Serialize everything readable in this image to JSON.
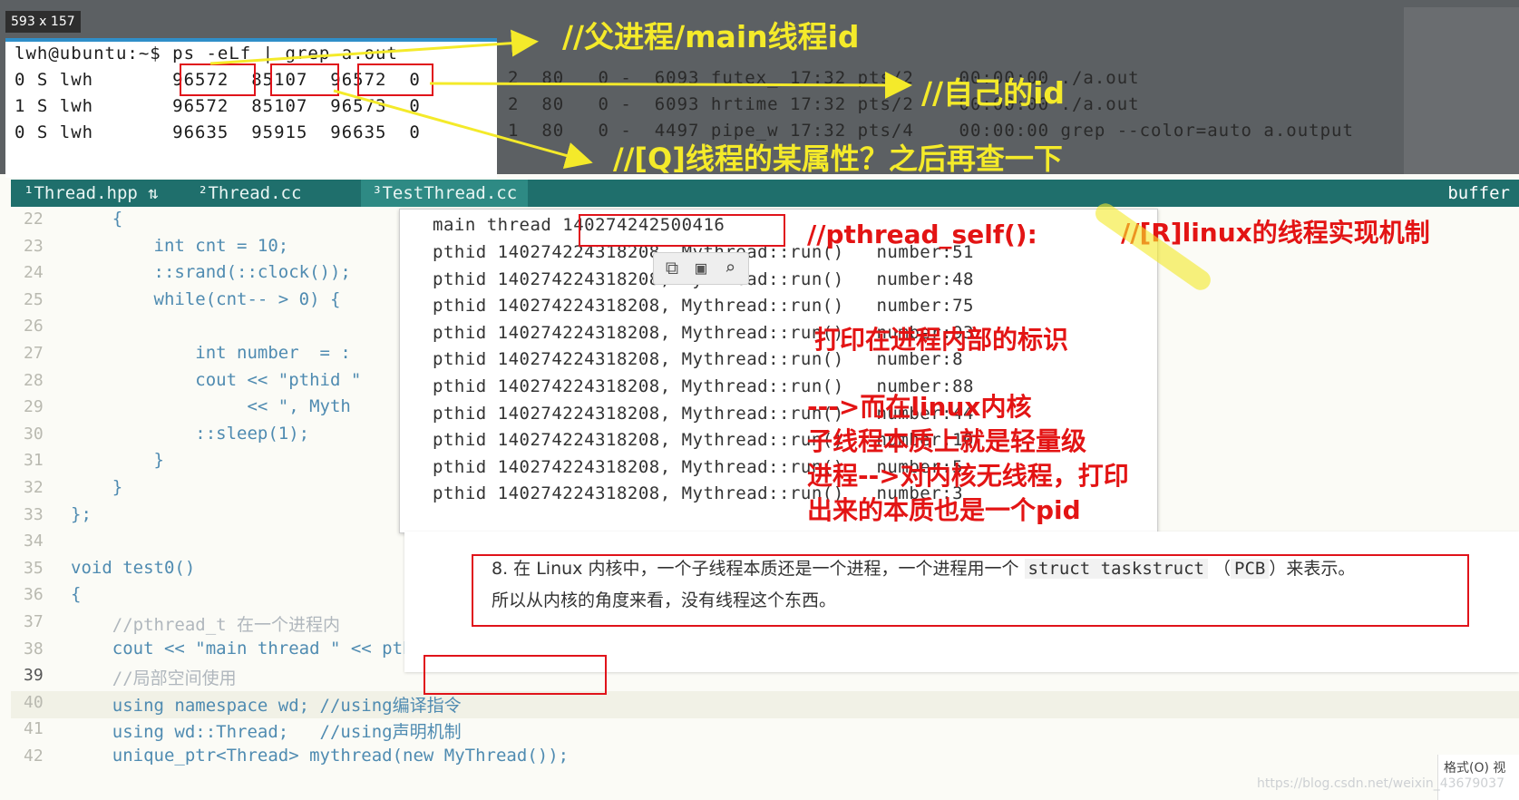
{
  "badge": "593 x 157",
  "terminal": {
    "prompt_line": "lwh@ubuntu:~$ ps -eLf | grep a.out",
    "rows": [
      "0 S lwh       96572  85107  96572  0",
      "1 S lwh       96572  85107  96573  0",
      "0 S lwh       96635  95915  96635  0"
    ],
    "ext_rows": [
      "2  80   0 -  6093 futex_ 17:32 pts/2    00:00:00 ./a.out",
      "2  80   0 -  6093 hrtime 17:32 pts/2    00:00:00 ./a.out",
      "1  80   0 -  4497 pipe_w 17:32 pts/4    00:00:00 grep --color=auto a.output"
    ]
  },
  "tabs": [
    {
      "label": "¹Thread.hpp ⇅"
    },
    {
      "label": "²Thread.cc"
    },
    {
      "label": "³TestThread.cc"
    }
  ],
  "buffer_label": "buffer",
  "code_lines": [
    {
      "n": "22",
      "t": "    {"
    },
    {
      "n": "23",
      "t": "        int cnt = 10;"
    },
    {
      "n": "24",
      "t": "        ::srand(::clock());"
    },
    {
      "n": "25",
      "t": "        while(cnt-- > 0) {"
    },
    {
      "n": "26",
      "t": ""
    },
    {
      "n": "27",
      "t": "            int number  = :"
    },
    {
      "n": "28",
      "t": "            cout << \"pthid \""
    },
    {
      "n": "29",
      "t": "                 << \", Myth"
    },
    {
      "n": "30",
      "t": "            ::sleep(1);"
    },
    {
      "n": "31",
      "t": "        }"
    },
    {
      "n": "32",
      "t": "    }"
    },
    {
      "n": "33",
      "t": "};"
    },
    {
      "n": "34",
      "t": ""
    },
    {
      "n": "35",
      "t": "void test0()"
    },
    {
      "n": "36",
      "t": "{"
    },
    {
      "n": "37",
      "t": "    //pthread_t 在一个进程内"
    },
    {
      "n": "38",
      "t": "    cout << \"main thread \" << pthread_self() << endl;"
    },
    {
      "n": "39",
      "t": "    //局部空间使用"
    },
    {
      "n": "40",
      "t": "    using namespace wd; //using编译指令"
    },
    {
      "n": "41",
      "t": "    using wd::Thread;   //using声明机制"
    },
    {
      "n": "42",
      "t": "    unique_ptr<Thread> mythread(new MyThread());"
    }
  ],
  "output": {
    "main_line": "main thread 140274242500416",
    "rows": [
      "pthid 140274224318208, Mythread::run()   number:51",
      "pthid 140274224318208, Mythread::run()   number:48",
      "pthid 140274224318208, Mythread::run()   number:75",
      "pthid 140274224318208, Mythread::run()   number:93",
      "pthid 140274224318208, Mythread::run()   number:8",
      "pthid 140274224318208, Mythread::run()   number:88",
      "pthid 140274224318208, Mythread::run()   number:44",
      "pthid 140274224318208, Mythread::run()   number:10",
      "pthid 140274224318208, Mythread::run()   number:5",
      "pthid 140274224318208, Mythread::run()   number:3"
    ]
  },
  "note": {
    "prefix": "8. 在 Linux 内核中，一个子线程本质还是一个进程，一个进程用一个",
    "code": "struct taskstruct",
    "middle": "（",
    "pcb": "PCB",
    "suffix": "）来表示。",
    "line2": "所以从内核的角度来看，没有线程这个东西。"
  },
  "annotations": {
    "parent_id": "//父进程/main线程id",
    "self_id": "//自己的id",
    "q_attr": "//[Q]线程的某属性？之后再查一下",
    "pthread_self": "//pthread_self():",
    "r_linux": "//[R]linux的线程实现机制",
    "print_inside": "打印在进程内部的标识",
    "kernel_lines": [
      "--->而在linux内核",
      "子线程本质上就是轻量级",
      "进程-->对内核无线程，打印",
      "出来的本质也是一个pid"
    ]
  },
  "watermark": "https://blog.csdn.net/weixin_43679037",
  "small_ui": "格式(O)  视",
  "colors": {
    "annotation_yellow": "#f4ea2a",
    "annotation_red": "#e31414",
    "tab_bar": "#1f6f6c"
  }
}
